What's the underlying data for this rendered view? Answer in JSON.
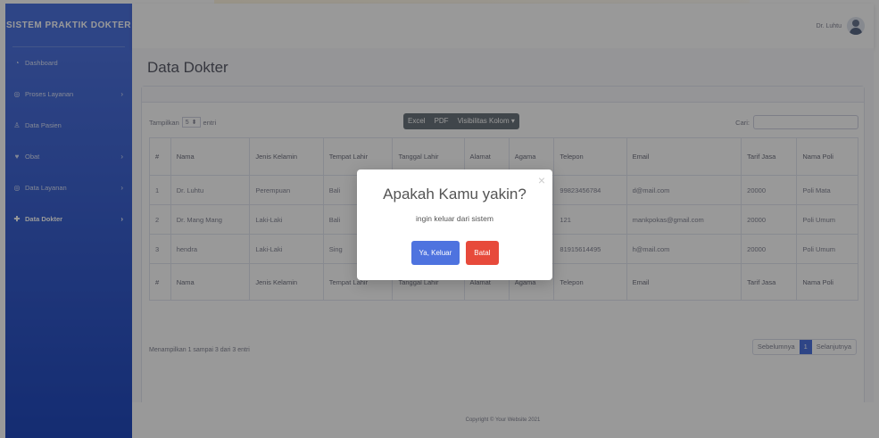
{
  "sidebar": {
    "brand": "SISTEM PRAKTIK DOKTER",
    "items": [
      {
        "icon": "dashboard-icon",
        "label": "Dashboard",
        "chevron": ""
      },
      {
        "icon": "process-icon",
        "label": "Proses Layanan",
        "chevron": "›"
      },
      {
        "icon": "patient-icon",
        "label": "Data Pasien",
        "chevron": ""
      },
      {
        "icon": "medicine-icon",
        "label": "Obat",
        "chevron": "›"
      },
      {
        "icon": "service-icon",
        "label": "Data Layanan",
        "chevron": "›"
      },
      {
        "icon": "doctor-icon",
        "label": "Data Dokter",
        "chevron": "›"
      }
    ]
  },
  "topbar": {
    "user": "Dr. Luhtu"
  },
  "page": {
    "title": "Data Dokter"
  },
  "table_controls": {
    "show_label": "Tampilkan",
    "show_value": "5",
    "entries": "entri",
    "buttons": [
      "Excel",
      "PDF",
      "Visibilitas Kolom ▾"
    ],
    "search_label": "Cari:"
  },
  "table": {
    "columns": [
      "#",
      "Nama",
      "Jenis Kelamin",
      "Tempat Lahir",
      "Tanggal Lahir",
      "Alamat",
      "Agama",
      "Telepon",
      "Email",
      "Tarif Jasa",
      "Nama Poli"
    ],
    "rows": [
      [
        "1",
        "Dr. Luhtu",
        "Perempuan",
        "Bali",
        "",
        "",
        "",
        "99823456784",
        "d@mail.com",
        "20000",
        "Poli Mata"
      ],
      [
        "2",
        "Dr. Mang Mang",
        "Laki-Laki",
        "Bali",
        "",
        "",
        "",
        "121",
        "mankpokas@gmail.com",
        "20000",
        "Poli Umum"
      ],
      [
        "3",
        "hendra",
        "Laki-Laki",
        "Sing",
        "",
        "",
        "",
        "81915614495",
        "h@mail.com",
        "20000",
        "Poli Umum"
      ]
    ]
  },
  "info": "Menampilkan 1 sampai 3 dari 3 entri",
  "pager": {
    "prev": "Sebelumnya",
    "current": "1",
    "next": "Selanjutnya"
  },
  "footer": "Copyright © Your Website 2021",
  "modal": {
    "title": "Apakah Kamu yakin?",
    "text": "ingin keluar dari sistem",
    "confirm": "Ya, Keluar",
    "cancel": "Batal",
    "close": "×"
  }
}
